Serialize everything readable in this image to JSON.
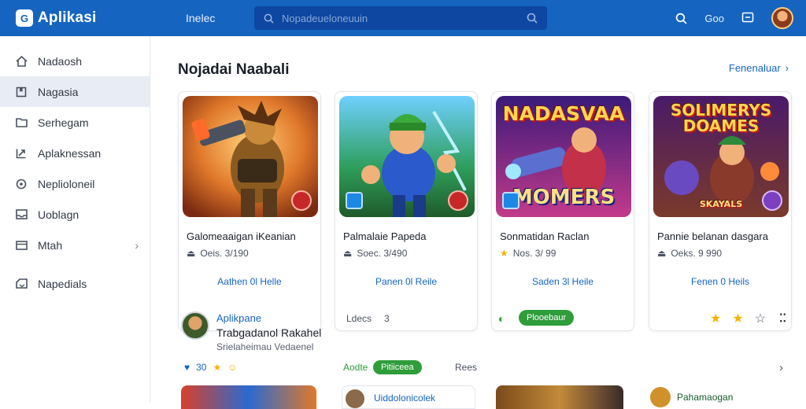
{
  "app": {
    "brand": "Aplikasi",
    "top_link": "Inelec",
    "search_placeholder": "Nopadeueloneuuin",
    "right_label": "Goo"
  },
  "sidebar": {
    "items": [
      {
        "label": "Nadaosh",
        "icon": "home-icon"
      },
      {
        "label": "Nagasia",
        "icon": "bookmark-icon",
        "active": true
      },
      {
        "label": "Serhegam",
        "icon": "folder-icon"
      },
      {
        "label": "Aplaknessan",
        "icon": "send-icon"
      },
      {
        "label": "Neplioloneil",
        "icon": "clock-icon"
      },
      {
        "label": "Uoblagn",
        "icon": "inbox-icon"
      },
      {
        "label": "Mtah",
        "icon": "card-icon",
        "has_chevron": true
      },
      {
        "label": "Napedials",
        "icon": "download-icon"
      }
    ]
  },
  "section": {
    "title": "Nojadai Naabali",
    "see_all": "Fenenaluar"
  },
  "cards": [
    {
      "title": "Galomeaaigan iKeanian",
      "meta": "Oeis. 3/190",
      "meta_icon": "thumb-icon",
      "action": "Aathen 0l Helle",
      "image_text": ""
    },
    {
      "title": "Palmalaie Papeda",
      "meta": "Soec. 3/490",
      "meta_icon": "thumb-icon",
      "action": "Panen 0l Reile",
      "image_text": ""
    },
    {
      "title": "Sonmatidan Raclan",
      "meta": "Nos. 3/ 99",
      "meta_icon": "star-icon",
      "action": "Saden 3l Heile",
      "image_text_top": "NADASVAA",
      "image_text_bottom": "MOMERS"
    },
    {
      "title": "Pannie belanan dasgara",
      "meta": "Oeks. 9 990",
      "meta_icon": "thumb-icon",
      "action": "Fenen 0 Heils",
      "image_text_top": "SOLIMERYS DOAMES",
      "image_text_bottom": "SKAYALS"
    }
  ],
  "row2": {
    "app_label": "Aplikpane",
    "name": "Trabgadanol Rakahel",
    "sub": "Srielaheimau Vedaenel",
    "mid_label": "Ldecs",
    "mid_value": "3",
    "pill": "Plooebaur"
  },
  "row3": {
    "like_count": "30",
    "open_label": "Aodte",
    "open_pill": "Pitiiceea",
    "rate_label": "Rees"
  },
  "bottom": {
    "label_2": "Uiddolonicolek",
    "label_4": "Pahamaogan"
  }
}
